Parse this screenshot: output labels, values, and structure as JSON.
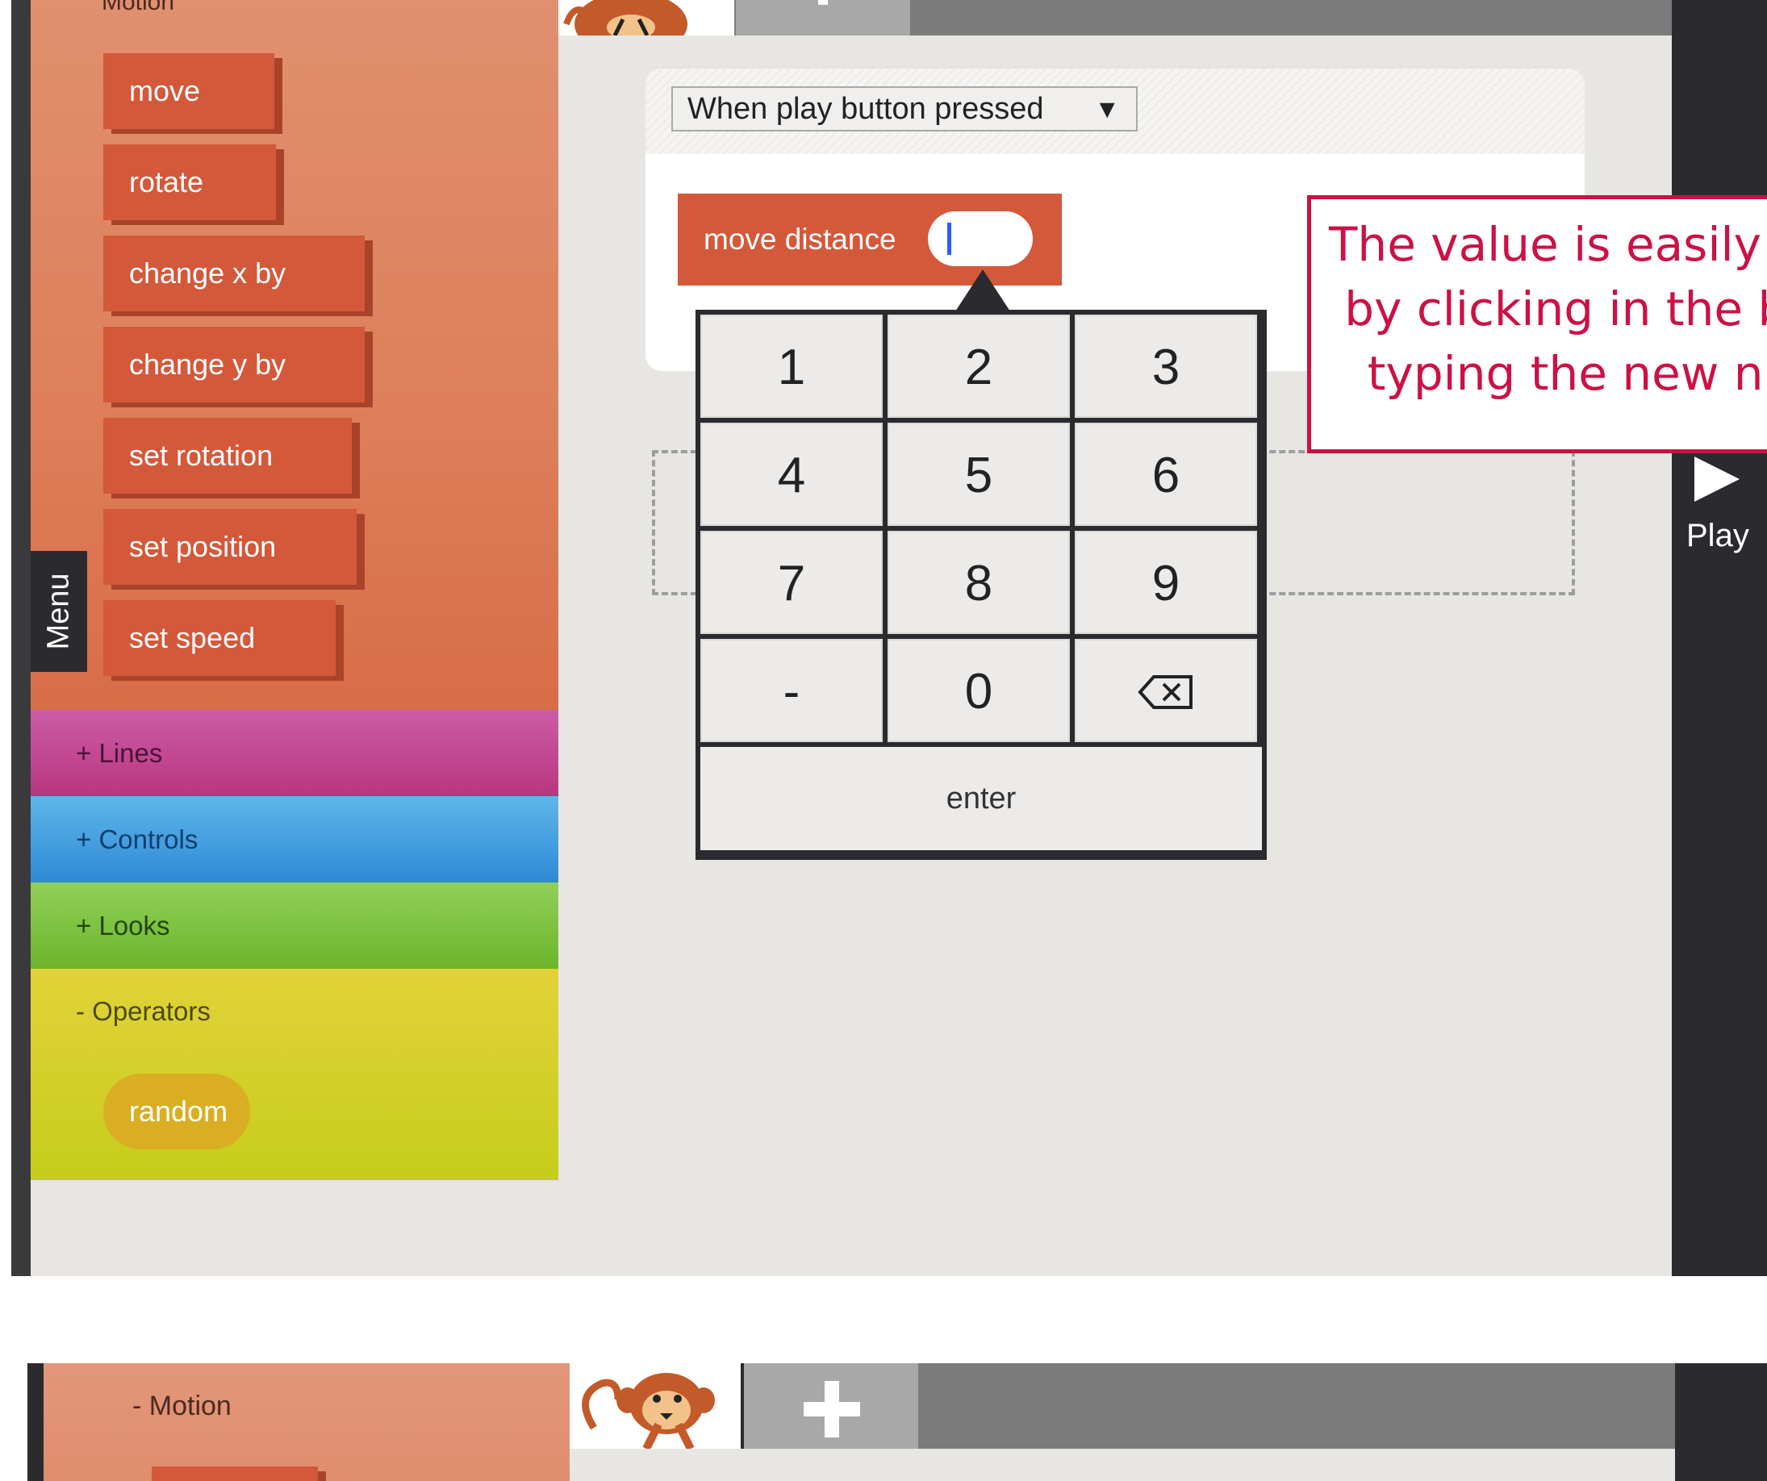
{
  "palette": {
    "motion_header": "Motion",
    "motion_blocks": [
      "move",
      "rotate",
      "change x by",
      "change y by",
      "set rotation",
      "set position",
      "set speed"
    ],
    "categories": {
      "lines": "+ Lines",
      "controls": "+ Controls",
      "looks": "+ Looks",
      "operators": "- Operators"
    },
    "operator_blocks": [
      "random"
    ],
    "menu_tab": "Menu"
  },
  "script": {
    "trigger": "When play button pressed",
    "trigger_arrow": "▼",
    "block_label": "move distance",
    "block_value": ""
  },
  "keypad": {
    "keys": [
      "1",
      "2",
      "3",
      "4",
      "5",
      "6",
      "7",
      "8",
      "9",
      "-",
      "0",
      "⌫"
    ],
    "enter": "enter"
  },
  "callout": {
    "text": "The value is easily ch\nby clicking in the bo\ntyping the new nu"
  },
  "side": {
    "play_label": "Play"
  },
  "second_screen": {
    "motion_header": "- Motion"
  },
  "colors": {
    "motion_block": "#d4583a",
    "lines": "#c04c94",
    "controls": "#3a95db",
    "looks": "#78bd38",
    "operators": "#d6d02a",
    "callout_border": "#cc1144",
    "dark_panel": "#2b2a2e"
  },
  "icons": {
    "sprite": "monkey-sprite-icon",
    "add": "plus-icon",
    "backspace": "backspace-icon",
    "play": "play-icon"
  }
}
